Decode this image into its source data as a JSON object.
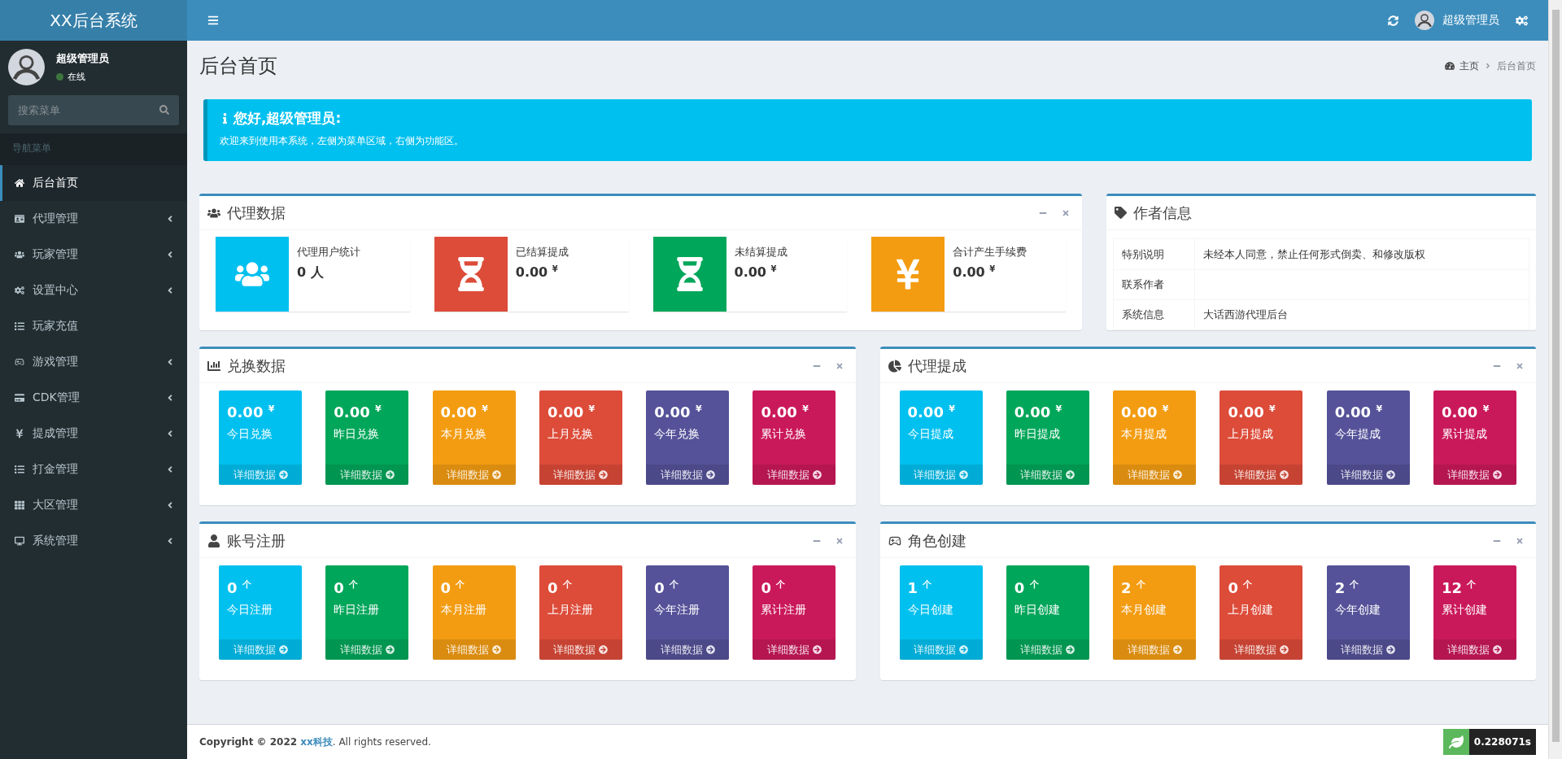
{
  "header": {
    "logo": "XX后台系统",
    "user": "超级管理员"
  },
  "sidebar": {
    "user": {
      "name": "超级管理员",
      "status": "在线",
      "online": true
    },
    "search": {
      "placeholder": "搜索菜单"
    },
    "section": "导航菜单",
    "items": [
      {
        "label": "后台首页",
        "selected": true,
        "expandable": false
      },
      {
        "label": "代理管理",
        "selected": false,
        "expandable": true
      },
      {
        "label": "玩家管理",
        "selected": false,
        "expandable": true
      },
      {
        "label": "设置中心",
        "selected": false,
        "expandable": true
      },
      {
        "label": "玩家充值",
        "selected": false,
        "expandable": false
      },
      {
        "label": "游戏管理",
        "selected": false,
        "expandable": true
      },
      {
        "label": "CDK管理",
        "selected": false,
        "expandable": true
      },
      {
        "label": "提成管理",
        "selected": false,
        "expandable": true
      },
      {
        "label": "打金管理",
        "selected": false,
        "expandable": true
      },
      {
        "label": "大区管理",
        "selected": false,
        "expandable": true
      },
      {
        "label": "系统管理",
        "selected": false,
        "expandable": true
      }
    ]
  },
  "page": {
    "title": "后台首页",
    "breadcrumb": [
      "主页",
      "后台首页"
    ]
  },
  "callout": {
    "title": "您好,超级管理员:",
    "text": "欢迎来到使用本系统，左侧为菜单区域，右侧为功能区。"
  },
  "agent_data": {
    "title": "代理数据",
    "items": [
      {
        "label": "代理用户统计",
        "value": "0 人",
        "color": "#00c0ef"
      },
      {
        "label": "已结算提成",
        "value": "0.00 $^{¥}$",
        "color": "#dd4b39"
      },
      {
        "label": "未结算提成",
        "value": "0.00 $^{¥}$",
        "color": "#00a65a"
      },
      {
        "label": "合计产生手续费",
        "value": "0.00 $^{¥}$",
        "color": "#f39c12"
      }
    ]
  },
  "author_info": {
    "title": "作者信息",
    "rows": [
      {
        "label": "特别说明",
        "value": "未经本人同意，禁止任何形式倒卖、和修改版权"
      },
      {
        "label": "联系作者"
      },
      {
        "label": "系统信息",
        "value": "大话西游代理后台"
      }
    ]
  },
  "stat_panels": [
    {
      "title": "兑换数据",
      "tiles": [
        {
          "value": "0.00 $^{¥}$",
          "label": "今日兑换",
          "link": "详细数据",
          "color": "#00c0ef"
        },
        {
          "value": "0.00 $^{¥}$",
          "label": "昨日兑换",
          "link": "详细数据",
          "color": "#00a65a"
        },
        {
          "value": "0.00 $^{¥}$",
          "label": "本月兑换",
          "link": "详细数据",
          "color": "#f39c12"
        },
        {
          "value": "0.00 $^{¥}$",
          "label": "上月兑换",
          "link": "详细数据",
          "color": "#dd4b39"
        },
        {
          "value": "0.00 $^{¥}$",
          "label": "今年兑换",
          "link": "详细数据",
          "color": "#555299"
        },
        {
          "value": "0.00 $^{¥}$",
          "label": "累计兑换",
          "link": "详细数据",
          "color": "#ca195a"
        }
      ]
    },
    {
      "title": "代理提成",
      "tiles": [
        {
          "value": "0.00 $^{¥}$",
          "label": "今日提成",
          "link": "详细数据",
          "color": "#00c0ef"
        },
        {
          "value": "0.00 $^{¥}$",
          "label": "昨日提成",
          "link": "详细数据",
          "color": "#00a65a"
        },
        {
          "value": "0.00 $^{¥}$",
          "label": "本月提成",
          "link": "详细数据",
          "color": "#f39c12"
        },
        {
          "value": "0.00 $^{¥}$",
          "label": "上月提成",
          "link": "详细数据",
          "color": "#dd4b39"
        },
        {
          "value": "0.00 $^{¥}$",
          "label": "今年提成",
          "link": "详细数据",
          "color": "#555299"
        },
        {
          "value": "0.00 $^{¥}$",
          "label": "累计提成",
          "link": "详细数据",
          "color": "#ca195a"
        }
      ]
    },
    {
      "title": "账号注册",
      "tiles": [
        {
          "value": "0 $^{个}$",
          "label": "今日注册",
          "link": "详细数据",
          "color": "#00c0ef"
        },
        {
          "value": "0 $^{个}$",
          "label": "昨日注册",
          "link": "详细数据",
          "color": "#00a65a"
        },
        {
          "value": "0 $^{个}$",
          "label": "本月注册",
          "link": "详细数据",
          "color": "#f39c12"
        },
        {
          "value": "0 $^{个}$",
          "label": "上月注册",
          "link": "详细数据",
          "color": "#dd4b39"
        },
        {
          "value": "0 $^{个}$",
          "label": "今年注册",
          "link": "详细数据",
          "color": "#555299"
        },
        {
          "value": "0 $^{个}$",
          "label": "累计注册",
          "link": "详细数据",
          "color": "#ca195a"
        }
      ]
    },
    {
      "title": "角色创建",
      "tiles": [
        {
          "value": "1 $^{个}$",
          "label": "今日创建",
          "link": "详细数据",
          "color": "#00c0ef"
        },
        {
          "value": "0 $^{个}$",
          "label": "昨日创建",
          "link": "详细数据",
          "color": "#00a65a"
        },
        {
          "value": "2 $^{个}$",
          "label": "本月创建",
          "link": "详细数据",
          "color": "#f39c12"
        },
        {
          "value": "0 $^{个}$",
          "label": "上月创建",
          "link": "详细数据",
          "color": "#dd4b39"
        },
        {
          "value": "2 $^{个}$",
          "label": "今年创建",
          "link": "详细数据",
          "color": "#555299"
        },
        {
          "value": "12 $^{个}$",
          "label": "累计创建",
          "link": "详细数据",
          "color": "#ca195a"
        }
      ]
    }
  ],
  "footer": {
    "copyright": "Copyright © 2022 ",
    "company": "xx科技",
    "rights": ". All rights reserved.",
    "trace": "0.228071s"
  }
}
